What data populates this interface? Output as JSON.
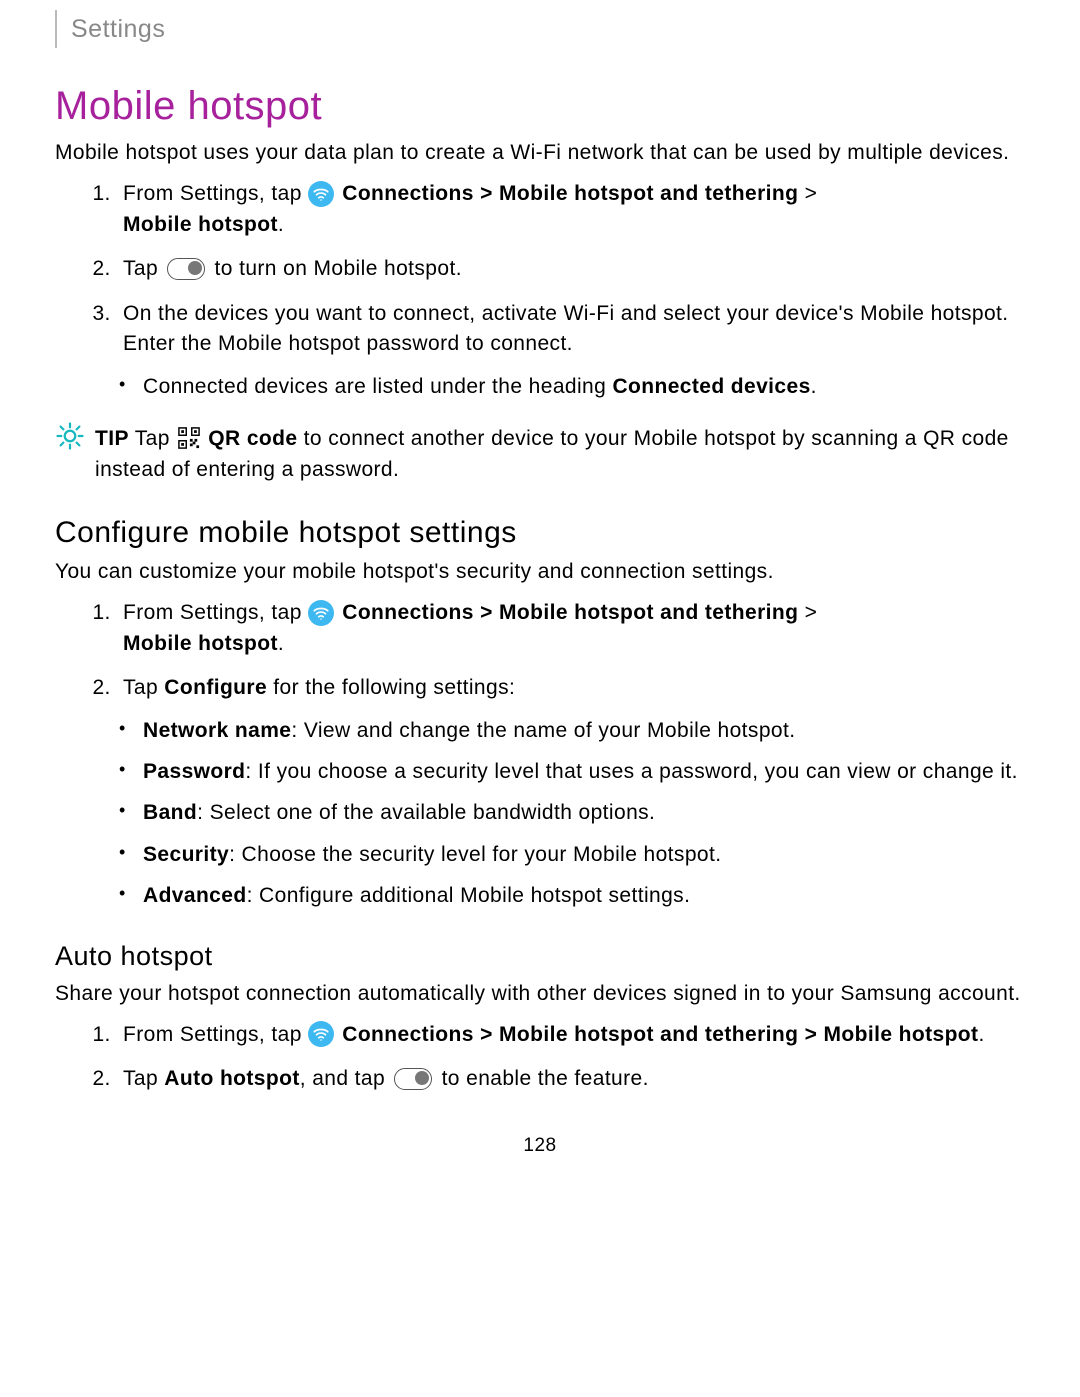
{
  "breadcrumb": "Settings",
  "title": "Mobile hotspot",
  "intro": "Mobile hotspot uses your data plan to create a Wi-Fi network that can be used by multiple devices.",
  "steps": {
    "s1_prefix": "From Settings, tap ",
    "s1_conn": "Connections",
    "s1_sep": " > ",
    "s1_mht": "Mobile hotspot and tethering",
    "s1_end": "Mobile hotspot",
    "s1_period": ".",
    "s2_prefix": "Tap ",
    "s2_suffix": " to turn on Mobile hotspot.",
    "s3": "On the devices you want to connect, activate Wi-Fi and select your device's Mobile hotspot. Enter the Mobile hotspot password to connect.",
    "s3_sub_prefix": "Connected devices are listed under the heading ",
    "s3_sub_bold": "Connected devices",
    "s3_sub_period": "."
  },
  "tip": {
    "label": "TIP",
    "prefix": "  Tap ",
    "qr_bold": "QR code",
    "rest": " to connect another device to your Mobile hotspot by scanning a QR code instead of entering a password."
  },
  "config": {
    "heading": "Configure mobile hotspot settings",
    "intro": "You can customize your mobile hotspot's security and connection settings.",
    "s2_prefix": "Tap ",
    "s2_bold": "Configure",
    "s2_suffix": " for the following settings:",
    "items": {
      "netname_b": "Network name",
      "netname_t": ": View and change the name of your Mobile hotspot.",
      "pwd_b": "Password",
      "pwd_t": ": If you choose a security level that uses a password, you can view or change it.",
      "band_b": "Band",
      "band_t": ": Select one of the available bandwidth options.",
      "sec_b": "Security",
      "sec_t": ": Choose the security level for your Mobile hotspot.",
      "adv_b": "Advanced",
      "adv_t": ": Configure additional Mobile hotspot settings."
    }
  },
  "auto": {
    "heading": "Auto hotspot",
    "intro": "Share your hotspot connection automatically with other devices signed in to your Samsung account.",
    "s1_mobile": "Mobile hotspot",
    "s2_prefix": "Tap ",
    "s2_bold": "Auto hotspot",
    "s2_mid": ", and tap ",
    "s2_suffix": " to enable the feature."
  },
  "page_num": "128"
}
